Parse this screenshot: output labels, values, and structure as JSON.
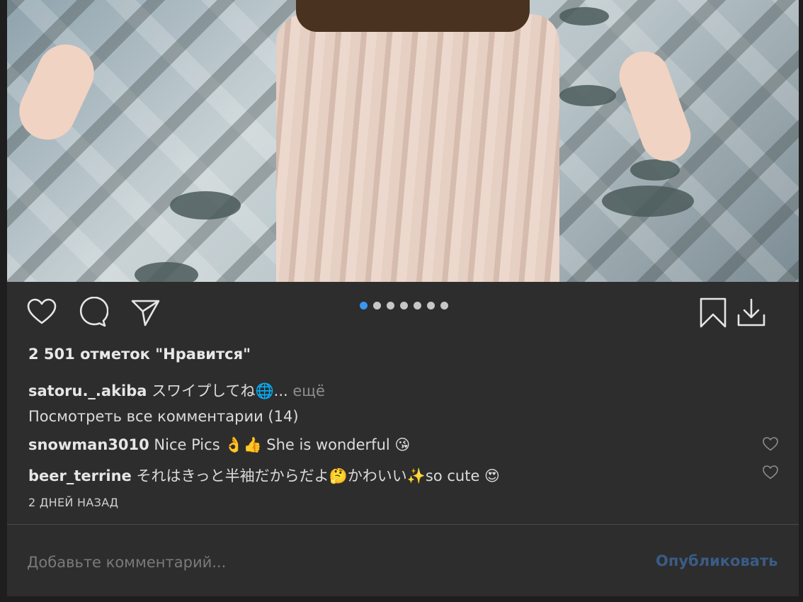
{
  "post": {
    "likes_text": "2 501 отметок \"Нравится\"",
    "carousel": {
      "total": 7,
      "active_index": 0
    },
    "caption": {
      "username": "satoru._.akiba",
      "text": "スワイプしてね🌐...",
      "more_label": "ещё"
    },
    "view_all_comments": "Посмотреть все комментарии (14)",
    "comments": [
      {
        "username": "snowman3010",
        "text": "Nice Pics 👌👍  She is wonderful  😘"
      },
      {
        "username": "beer_terrine",
        "text": "それはきっと半袖だからだよ🤔かわいい✨so cute  😍"
      }
    ],
    "timestamp": "2 ДНЕЙ НАЗАД",
    "add_comment_placeholder": "Добавьте комментарий...",
    "publish_label": "Опубликовать"
  },
  "icons": {
    "like": "heart-icon",
    "comment": "speech-bubble-icon",
    "share": "paper-plane-icon",
    "save": "bookmark-icon",
    "download": "download-icon"
  },
  "colors": {
    "background": "#2d2d2d",
    "active_dot": "#3897f0",
    "publish": "#3a5c86"
  }
}
